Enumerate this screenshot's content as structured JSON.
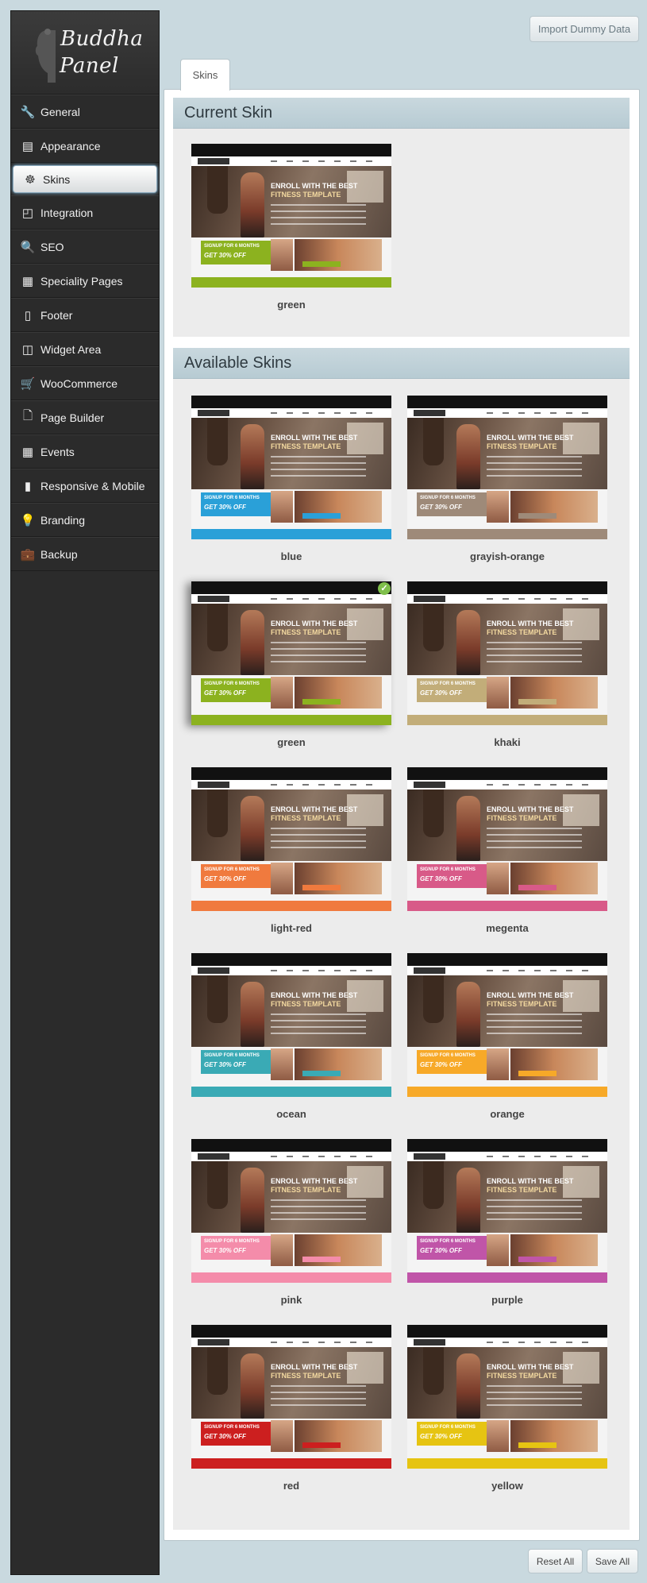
{
  "logo": {
    "line1": "Buddha",
    "line2": "Panel"
  },
  "sidebar": {
    "items": [
      {
        "label": "General",
        "icon": "wrench-icon"
      },
      {
        "label": "Appearance",
        "icon": "document-icon"
      },
      {
        "label": "Skins",
        "icon": "ship-wheel-icon",
        "active": true
      },
      {
        "label": "Integration",
        "icon": "window-cursor-icon"
      },
      {
        "label": "SEO",
        "icon": "search-icon"
      },
      {
        "label": "Speciality Pages",
        "icon": "grid-icon"
      },
      {
        "label": "Footer",
        "icon": "phone-icon"
      },
      {
        "label": "Widget Area",
        "icon": "layout-icon"
      },
      {
        "label": "WooCommerce",
        "icon": "cart-icon"
      },
      {
        "label": "Page Builder",
        "icon": "page-add-icon"
      },
      {
        "label": "Events",
        "icon": "calendar-icon"
      },
      {
        "label": "Responsive & Mobile",
        "icon": "tablet-icon"
      },
      {
        "label": "Branding",
        "icon": "lightbulb-icon"
      },
      {
        "label": "Backup",
        "icon": "briefcase-icon"
      }
    ]
  },
  "header": {
    "import_label": "Import Dummy Data"
  },
  "tabs": [
    {
      "label": "Skins"
    }
  ],
  "current": {
    "title": "Current Skin",
    "skin": {
      "name": "green",
      "color": "#8cb21f"
    }
  },
  "available": {
    "title": "Available Skins",
    "skins": [
      {
        "name": "blue",
        "color": "#2aa0d8"
      },
      {
        "name": "grayish-orange",
        "color": "#9e8a79"
      },
      {
        "name": "green",
        "color": "#8cb21f",
        "selected": true
      },
      {
        "name": "khaki",
        "color": "#c2ad79"
      },
      {
        "name": "light-red",
        "color": "#f07a3e"
      },
      {
        "name": "megenta",
        "color": "#d85a88"
      },
      {
        "name": "ocean",
        "color": "#3aaab5"
      },
      {
        "name": "orange",
        "color": "#f7a928"
      },
      {
        "name": "pink",
        "color": "#f48caa"
      },
      {
        "name": "purple",
        "color": "#c055a8"
      },
      {
        "name": "red",
        "color": "#cc1f1f"
      },
      {
        "name": "yellow",
        "color": "#e6c412"
      }
    ]
  },
  "thumbnail": {
    "headline1": "ENROLL WITH THE BEST",
    "headline2": "FITNESS TEMPLATE",
    "promo1": "SIGNUP FOR 6 MONTHS",
    "promo2": "GET 30% OFF"
  },
  "footer": {
    "reset_label": "Reset All",
    "save_label": "Save All"
  }
}
